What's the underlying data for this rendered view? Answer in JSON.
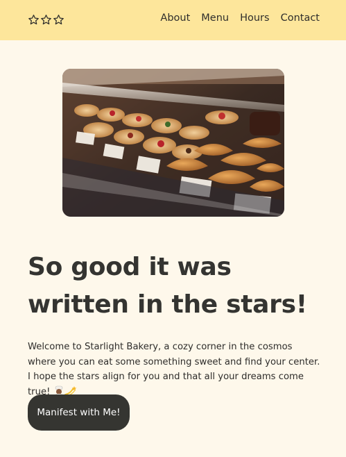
{
  "header": {
    "logo_icon": "three-star-outline-icon",
    "nav": [
      {
        "label": "About"
      },
      {
        "label": "Menu"
      },
      {
        "label": "Hours"
      },
      {
        "label": "Contact"
      }
    ]
  },
  "hero": {
    "image": "bakery-display-case-photo",
    "headline": "So good it was written in the stars!",
    "intro": "Welcome to Starlight Bakery, a cozy corner in the cosmos where you can eat some something sweet and find your center. I hope the stars align for you and that all your dreams come true!",
    "emoji_icons": [
      "chef-emoji-icon",
      "dizzy-star-emoji-icon"
    ],
    "cta_label": "Manifest with Me!"
  },
  "colors": {
    "header_bg": "#fde69b",
    "page_bg": "#fef8eb",
    "button_bg": "#353531",
    "text": "#333230"
  }
}
